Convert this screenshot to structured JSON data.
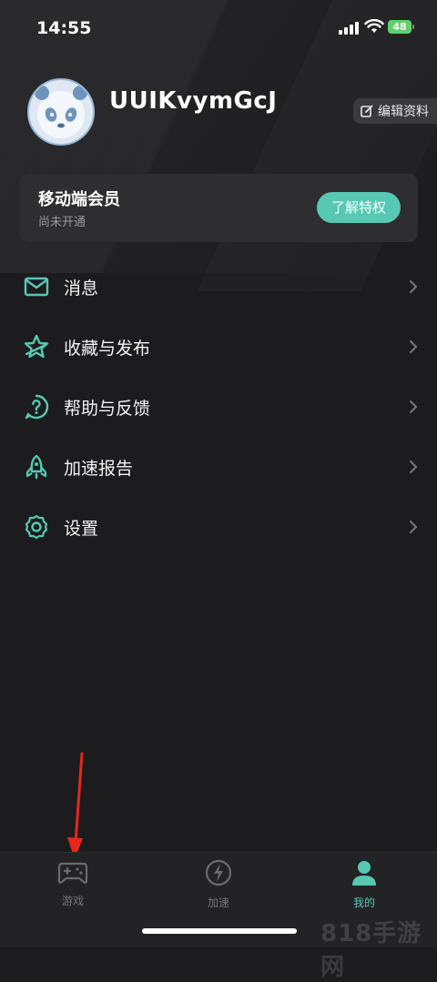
{
  "status_bar": {
    "time": "14:55",
    "battery": "48"
  },
  "profile": {
    "username": "UUIKvymGcJ",
    "edit_label": "编辑资料"
  },
  "vip": {
    "title": "移动端会员",
    "subtitle": "尚未开通",
    "button_label": "了解特权"
  },
  "menu": {
    "items": [
      {
        "label": "消息",
        "icon": "mail-icon"
      },
      {
        "label": "收藏与发布",
        "icon": "star-icon"
      },
      {
        "label": "帮助与反馈",
        "icon": "help-icon"
      },
      {
        "label": "加速报告",
        "icon": "rocket-icon"
      },
      {
        "label": "设置",
        "icon": "gear-icon"
      }
    ]
  },
  "tabbar": {
    "tabs": [
      {
        "label": "游戏",
        "icon": "gamepad-icon",
        "active": false
      },
      {
        "label": "加速",
        "icon": "lightning-icon",
        "active": false
      },
      {
        "label": "我的",
        "icon": "person-icon",
        "active": true
      }
    ]
  },
  "watermark": "818手游网",
  "colors": {
    "accent": "#56c8b4",
    "background": "#1c1c1e",
    "card": "#2e2e30",
    "annotation": "#e8261c"
  }
}
